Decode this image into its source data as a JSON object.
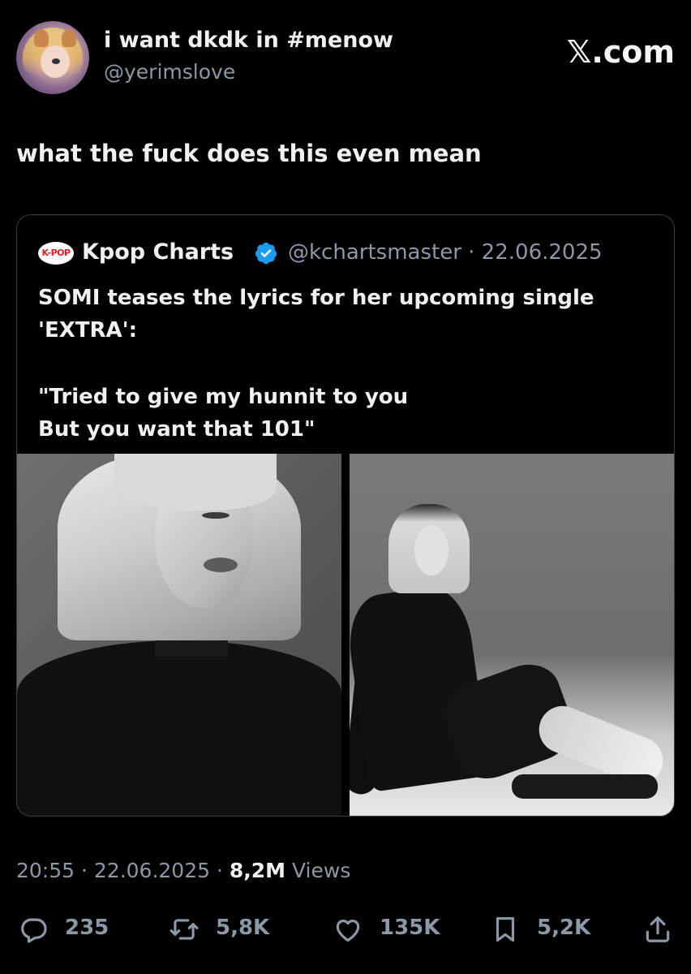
{
  "author": {
    "display_name": "i want dkdk in #menow",
    "handle": "@yerimslove"
  },
  "brand": "𝕏.com",
  "tweet": {
    "text": "what the fuck does this even mean"
  },
  "quoted_tweet": {
    "logo_text": "K-POP",
    "name": "Kpop Charts",
    "verified": true,
    "handle_date": "@kchartsmaster · 22.06.2025",
    "lines": [
      "SOMI teases the lyrics for her upcoming single",
      "'EXTRA':",
      "",
      "\"Tried to give my hunnit to you",
      "But you want that 101\""
    ]
  },
  "meta": {
    "time_date": "20:55 · 22.06.2025 · ",
    "views_count": "8,2M",
    "views_label": " Views"
  },
  "actions": {
    "replies": "235",
    "retweets": "5,8K",
    "likes": "135K",
    "bookmarks": "5,2K"
  },
  "colors": {
    "background": "#000000",
    "text": "#f0f0f0",
    "secondary_text": "#8b98a5",
    "verified": "#1d9bf0",
    "border": "#3a3e43"
  }
}
